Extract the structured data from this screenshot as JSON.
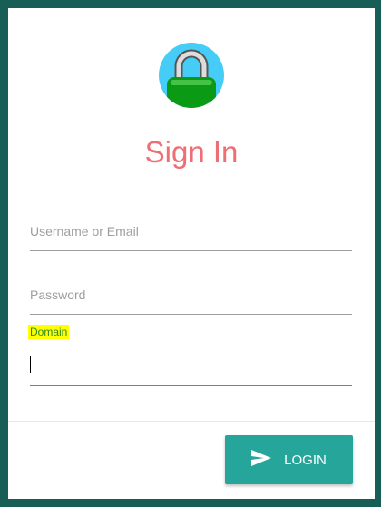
{
  "title": "Sign In",
  "fields": {
    "username": {
      "placeholder": "Username or Email",
      "value": ""
    },
    "password": {
      "placeholder": "Password",
      "value": ""
    },
    "domain": {
      "label": "Domain",
      "value": ""
    }
  },
  "login_button": {
    "label": "LOGIN",
    "icon": "send-icon"
  },
  "colors": {
    "accent": "#26a69a",
    "title": "#ee6e73",
    "background": "#175e57"
  }
}
